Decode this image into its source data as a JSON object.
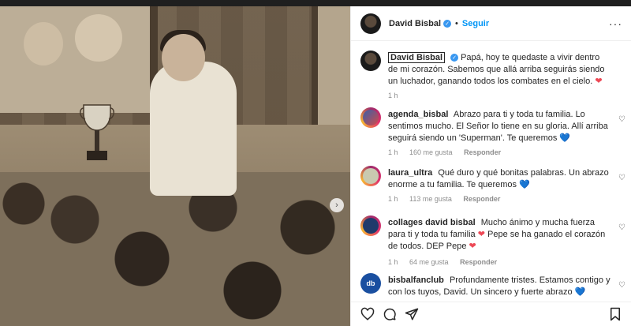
{
  "header": {
    "username": "David Bisbal",
    "separator": "•",
    "follow_label": "Seguir",
    "more_label": "···"
  },
  "comments": [
    {
      "user": "David Bisbal",
      "text": "Papá, hoy te quedaste a vivir dentro de mi corazón. Sabemos que allá arriba seguirás siendo un luchador, ganando todos los combates en el cielo.",
      "emoji": "❤",
      "time": "1 h",
      "likes": "",
      "reply": ""
    },
    {
      "user": "agenda_bisbal",
      "text": "Abrazo para ti y toda tu familia. Lo sentimos mucho. El Señor lo tiene en su gloria. Allí arriba seguirá siendo un 'Superman'. Te queremos",
      "emoji": "💙",
      "time": "1 h",
      "likes": "160 me gusta",
      "reply": "Responder"
    },
    {
      "user": "laura_ultra",
      "text": "Qué duro y qué bonitas palabras. Un abrazo enorme a tu familia. Te queremos",
      "emoji": "💙",
      "time": "1 h",
      "likes": "113 me gusta",
      "reply": "Responder"
    },
    {
      "user": "collages david bisbal",
      "text_1": "Mucho ánimo y mucha fuerza para ti y toda tu familia",
      "emoji_1": "❤",
      "text_2": "Pepe se ha ganado el corazón de todos. DEP Pepe",
      "emoji_2": "❤",
      "time": "1 h",
      "likes": "64 me gusta",
      "reply": "Responder"
    },
    {
      "user": "bisbalfanclub",
      "text": "Profundamente tristes. Estamos contigo y con los tuyos, David. Un sincero y fuerte abrazo",
      "emoji": "💙",
      "avatar_text": "db"
    }
  ],
  "icons": {
    "heart": "♡",
    "comment": "◯",
    "share": "➤",
    "save": "⌑",
    "next": "›"
  },
  "colors": {
    "follow": "#0095f6",
    "verified": "#3897f0",
    "heart_red": "#ed4956"
  }
}
